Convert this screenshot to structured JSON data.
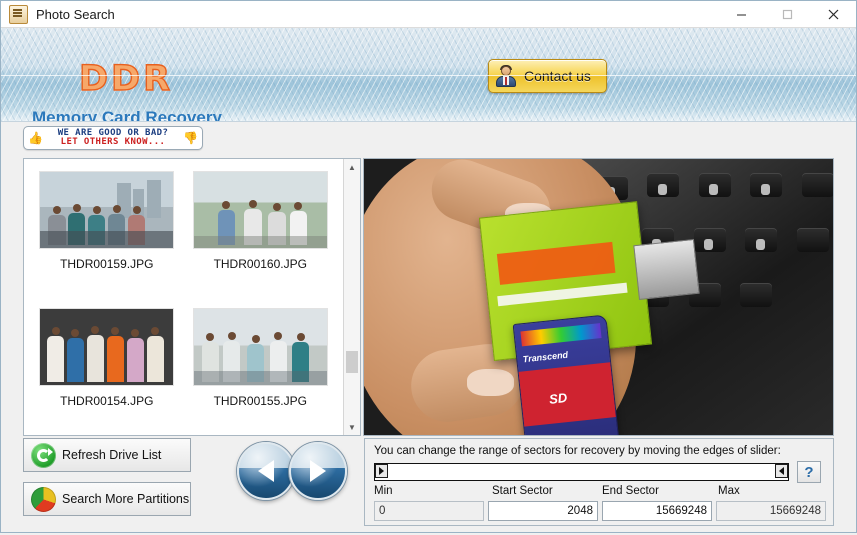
{
  "window": {
    "title": "Photo Search",
    "icon": "photo-search-icon",
    "controls": {
      "minimize": "—",
      "maximize": "□",
      "close": "✕"
    }
  },
  "header": {
    "logo": "DDR",
    "subtitle": "Memory Card Recovery",
    "contact_label": "Contact us"
  },
  "feedback": {
    "line1": "WE ARE GOOD OR BAD?",
    "line2": "LET OTHERS KNOW..."
  },
  "thumbnails": [
    {
      "label": "THDR00159.JPG"
    },
    {
      "label": "THDR00160.JPG"
    },
    {
      "label": "THDR00154.JPG"
    },
    {
      "label": "THDR00155.JPG"
    }
  ],
  "preview": {
    "sd_brand": "Transcend",
    "sd_logo": "SD"
  },
  "buttons": {
    "refresh_drive_list": "Refresh Drive List",
    "search_more_partitions": "Search More Partitions",
    "prev": "◀",
    "next": "▶"
  },
  "sector_panel": {
    "note": "You can change the range of sectors for recovery by moving the edges of slider:",
    "help": "?",
    "labels": {
      "min": "Min",
      "start": "Start Sector",
      "end": "End Sector",
      "max": "Max"
    },
    "values": {
      "min": "0",
      "start": "2048",
      "end": "15669248",
      "max": "15669248"
    }
  },
  "colors": {
    "logo_orange": "#e8601e",
    "subtitle_blue": "#2b79bc",
    "contact_gold": "#eec22c",
    "help_blue": "#2b6ca8",
    "feedback_blue": "#1b3d80",
    "feedback_red": "#cc2020"
  }
}
